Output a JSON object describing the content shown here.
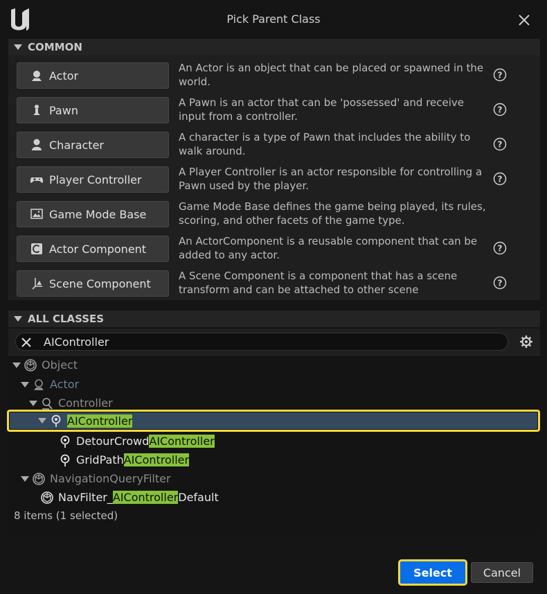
{
  "window": {
    "title": "Pick Parent Class"
  },
  "common": {
    "header": "COMMON",
    "items": [
      {
        "label": "Actor",
        "icon": "actor-icon",
        "description": "An Actor is an object that can be placed or spawned in the world."
      },
      {
        "label": "Pawn",
        "icon": "pawn-icon",
        "description": "A Pawn is an actor that can be 'possessed' and receive input from a controller."
      },
      {
        "label": "Character",
        "icon": "character-icon",
        "description": "A character is a type of Pawn that includes the ability to walk around."
      },
      {
        "label": "Player Controller",
        "icon": "gamepad-icon",
        "description": "A Player Controller is an actor responsible for controlling a Pawn used by the player."
      },
      {
        "label": "Game Mode Base",
        "icon": "game-mode-icon",
        "description": "Game Mode Base defines the game being played, its rules, scoring, and other facets of the game type."
      },
      {
        "label": "Actor Component",
        "icon": "component-icon",
        "description": "An ActorComponent is a reusable component that can be added to any actor."
      },
      {
        "label": "Scene Component",
        "icon": "scene-component-icon",
        "description": "A Scene Component is a component that has a scene transform and can be attached to other scene"
      }
    ]
  },
  "all_classes": {
    "header": "ALL CLASSES",
    "search_value": "AIController",
    "tree": [
      {
        "text": "Object",
        "pre": "",
        "match": "",
        "post": ""
      },
      {
        "text": "Actor",
        "pre": "",
        "match": "",
        "post": ""
      },
      {
        "text": "Controller",
        "pre": "",
        "match": "",
        "post": ""
      },
      {
        "text": "",
        "pre": "",
        "match": "AIController",
        "post": ""
      },
      {
        "text": "",
        "pre": "DetourCrowd",
        "match": "AIController",
        "post": ""
      },
      {
        "text": "",
        "pre": "GridPath",
        "match": "AIController",
        "post": ""
      },
      {
        "text": "NavigationQueryFilter",
        "pre": "",
        "match": "",
        "post": ""
      },
      {
        "text": "",
        "pre": "NavFilter_",
        "match": "AIController",
        "post": "Default"
      }
    ],
    "status": "8 items (1 selected)"
  },
  "buttons": {
    "select": "Select",
    "cancel": "Cancel"
  },
  "colors": {
    "accent": "#0a6ee8",
    "highlight_match": "#86c23a",
    "focus_outline": "#f5d93a",
    "selection": "#34495e"
  }
}
